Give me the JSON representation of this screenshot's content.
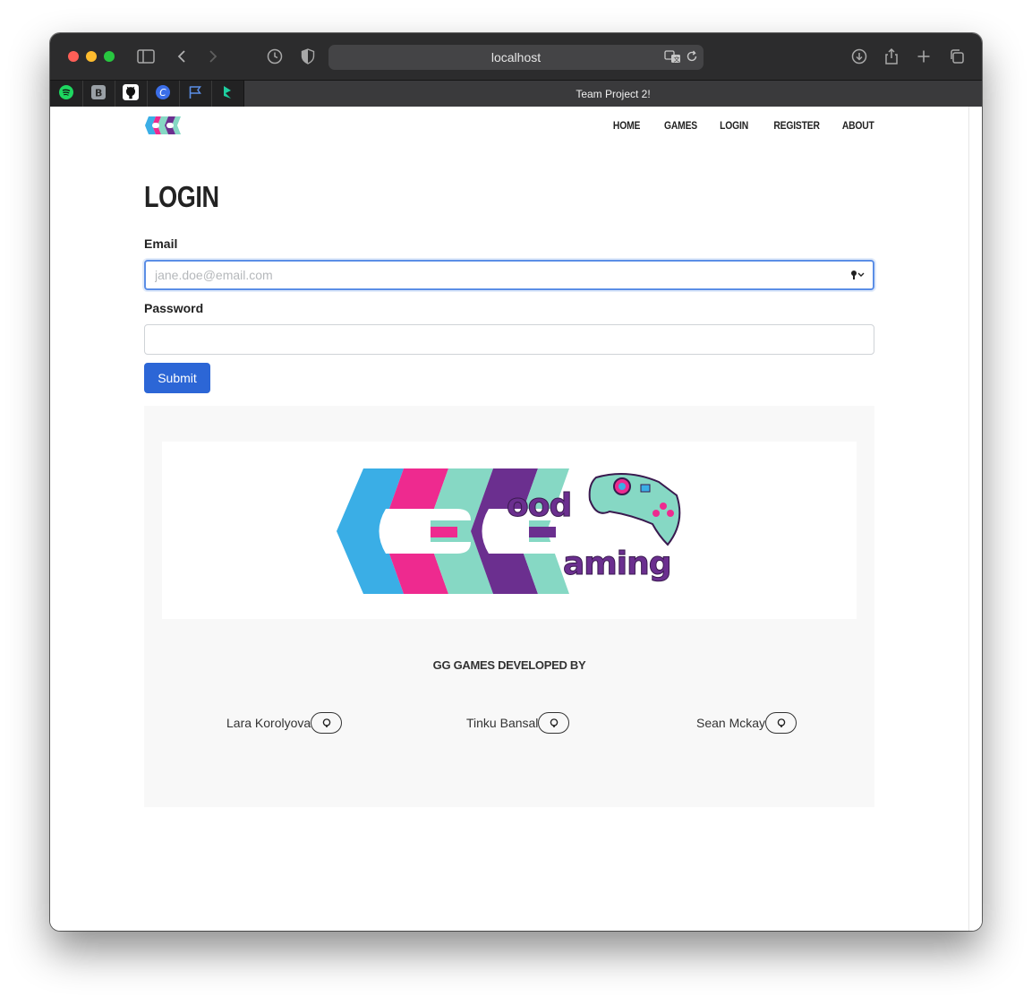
{
  "browser": {
    "url": "localhost",
    "tab_title": "Team Project 2!",
    "pinned_tabs": [
      {
        "icon": "spotify-icon",
        "color": "#1ed760"
      },
      {
        "icon": "bootstrap-icon",
        "color": "#9aa0a6",
        "letter": "B"
      },
      {
        "icon": "github-icon",
        "color": "#ffffff"
      },
      {
        "icon": "c-app-icon",
        "color": "#3b6ee8",
        "letter": "C"
      },
      {
        "icon": "flag-icon",
        "color": "#5b8ee6"
      },
      {
        "icon": "leaf-icon",
        "color": "#1ecfa0"
      }
    ]
  },
  "nav": {
    "items": [
      {
        "label": "Home"
      },
      {
        "label": "Games"
      },
      {
        "label": "Login"
      },
      {
        "label": "Register"
      },
      {
        "label": "About"
      }
    ]
  },
  "page": {
    "title": "LOGIN"
  },
  "form": {
    "email_label": "Email",
    "email_placeholder": "jane.doe@email.com",
    "password_label": "Password",
    "submit_label": "Submit"
  },
  "footer": {
    "developed_by": "GG GAMES DEVELOPED BY",
    "developers": [
      {
        "name": "Lara Korolyova"
      },
      {
        "name": "Tinku Bansal"
      },
      {
        "name": "Sean Mckay"
      }
    ]
  },
  "colors": {
    "accent_blue": "#2c66d6",
    "brand_blue": "#3aaee6",
    "brand_pink": "#ee2a8f",
    "brand_purple": "#6b2f8f",
    "brand_mint": "#86d8c4"
  }
}
